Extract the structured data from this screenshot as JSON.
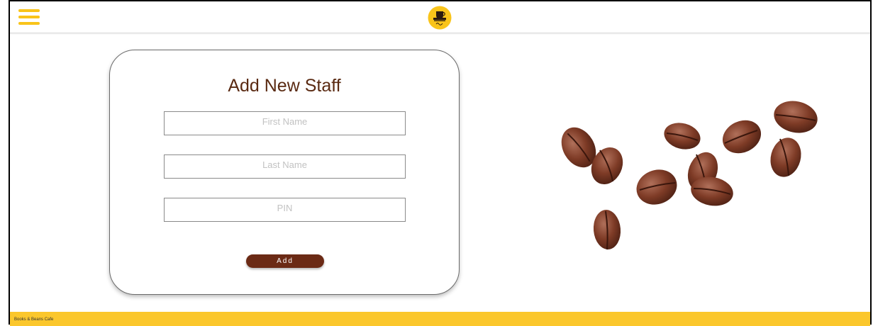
{
  "header": {
    "menu_icon": "hamburger-menu-icon",
    "logo_icon": "cafe-logo-icon"
  },
  "form": {
    "title": "Add New Staff",
    "first_name_placeholder": "First Name",
    "last_name_placeholder": "Last Name",
    "pin_placeholder": "PIN",
    "add_label": "Add"
  },
  "decor": {
    "image_icon": "coffee-beans-illustration"
  },
  "footer": {
    "text": "Books & Beans Cafe"
  },
  "colors": {
    "accent": "#f9c41a",
    "brand_brown": "#6b2a15",
    "title_brown": "#5a2a12",
    "footer_bg": "#fbc72c"
  }
}
